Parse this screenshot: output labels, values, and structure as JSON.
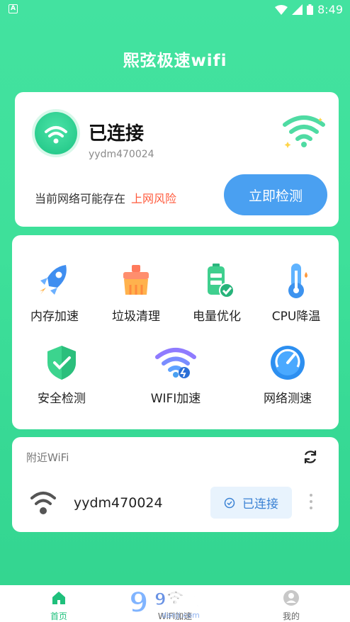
{
  "status_bar": {
    "left_badge": "A",
    "time": "8:49"
  },
  "app_title": "熙弦极速wifi",
  "connection": {
    "status": "已连接",
    "ssid": "yydm470024",
    "risk_prefix": "当前网络可能存在",
    "risk_word": "上网风险",
    "detect_button": "立即检测"
  },
  "tools": [
    {
      "label": "内存加速",
      "icon": "rocket-icon"
    },
    {
      "label": "垃圾清理",
      "icon": "brush-icon"
    },
    {
      "label": "电量优化",
      "icon": "battery-icon"
    },
    {
      "label": "CPU降温",
      "icon": "thermometer-icon"
    },
    {
      "label": "安全检测",
      "icon": "shield-icon"
    },
    {
      "label": "WIFI加速",
      "icon": "wifi-boost-icon"
    },
    {
      "label": "网络测速",
      "icon": "speedometer-icon"
    }
  ],
  "nearby": {
    "title": "附近WiFi",
    "networks": [
      {
        "ssid": "yydm470024",
        "status": "已连接"
      }
    ]
  },
  "tabs": [
    {
      "label": "首页",
      "icon": "home-icon",
      "active": true
    },
    {
      "label": "WiFi加速",
      "icon": "wifi-icon",
      "active": false
    },
    {
      "label": "我的",
      "icon": "profile-icon",
      "active": false
    }
  ],
  "watermark": {
    "text": "9游戏",
    "sub": "danji.com"
  },
  "colors": {
    "accent": "#3ee09a",
    "button_blue": "#4aa0f1",
    "risk_red": "#ff5a3c",
    "active_tab": "#1fc07c"
  }
}
